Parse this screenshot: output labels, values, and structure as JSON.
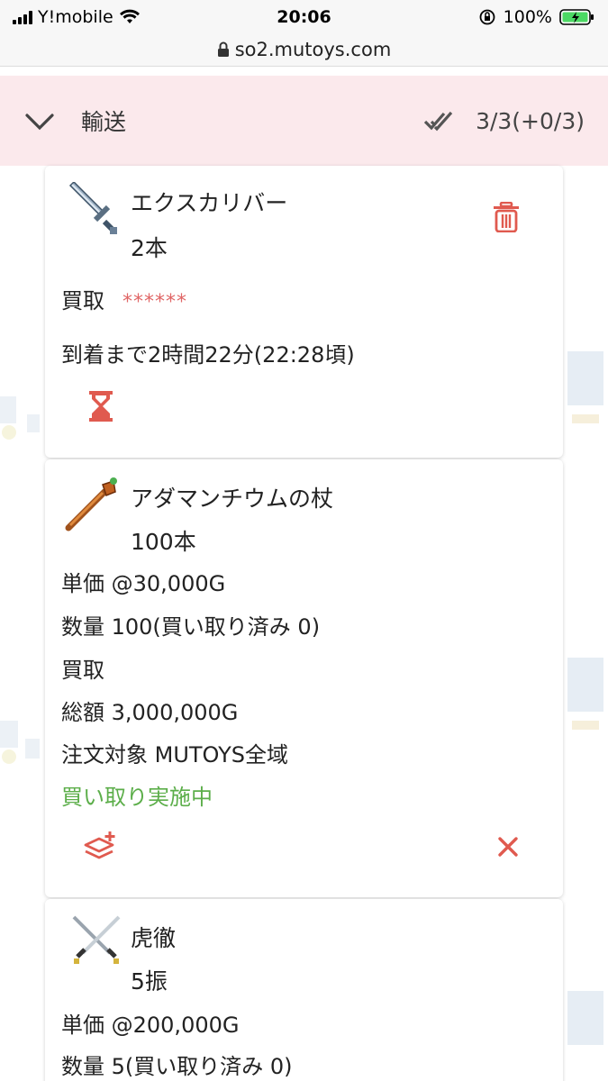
{
  "status_bar": {
    "carrier": "Y!mobile",
    "time": "20:06",
    "battery": "100%"
  },
  "url_bar": {
    "url": "so2.mutoys.com"
  },
  "section": {
    "title": "輸送",
    "count": "3/3(+0/3)"
  },
  "cards": [
    {
      "name": "エクスカリバー",
      "quantity": "2本",
      "type_label": "買取",
      "masked": "******",
      "arrival": "到着まで2時間22分(22:28頃)"
    },
    {
      "name": "アダマンチウムの杖",
      "quantity": "100本",
      "unit_price": "単価 @30,000G",
      "count": "数量 100(買い取り済み 0)",
      "type_label": "買取",
      "total": "総額 3,000,000G",
      "target": "注文対象 MUTOYS全域",
      "status": "買い取り実施中"
    },
    {
      "name": "虎徹",
      "quantity": "5振",
      "unit_price": "単価 @200,000G",
      "count": "数量 5(買い取り済み 0)"
    }
  ],
  "colors": {
    "accent_red": "#e05a4f",
    "status_green": "#5cae4a",
    "header_pink": "#fbe9ec"
  }
}
